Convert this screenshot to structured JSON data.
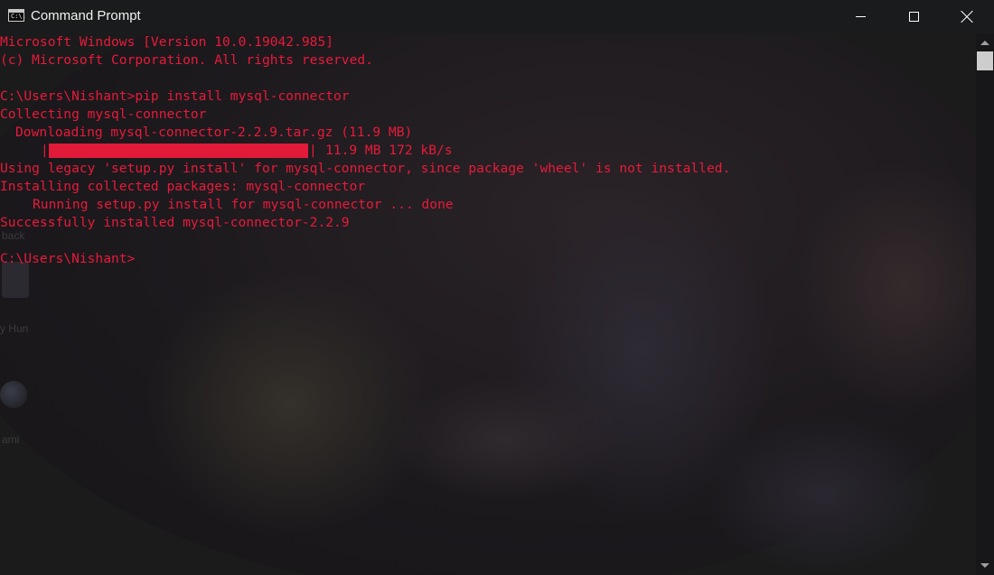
{
  "window": {
    "title": "Command Prompt",
    "icon": "cmd-icon",
    "icon_text": "C:\\.",
    "controls": {
      "minimize": "minimize-icon",
      "maximize": "maximize-icon",
      "close": "close-icon"
    }
  },
  "colors": {
    "console_text": "#e81a3a",
    "titlebar": "#1a1b1c",
    "progress_fill": "#e11a3a"
  },
  "console": {
    "lines": [
      "Microsoft Windows [Version 10.0.19042.985]",
      "(c) Microsoft Corporation. All rights reserved.",
      "",
      "C:\\Users\\Nishant>pip install mysql-connector",
      "Collecting mysql-connector",
      "Downloading mysql-connector-2.2.9.tar.gz (11.9 MB)"
    ],
    "progress": {
      "fraction": 1.0,
      "left_bar": "|",
      "right_bar": "|",
      "text": "11.9 MB 172 kB/s"
    },
    "lines_after": [
      "Using legacy 'setup.py install' for mysql-connector, since package 'wheel' is not installed.",
      "Installing collected packages: mysql-connector",
      "Running setup.py install for mysql-connector ... done",
      "Successfully installed mysql-connector-2.2.9",
      "",
      "C:\\Users\\Nishant>"
    ]
  },
  "background_desktop": {
    "labels": [
      "back",
      "y Hun",
      "ami"
    ]
  },
  "scrollbar": {
    "up": "scroll-up-arrow-icon",
    "down": "scroll-down-arrow-icon"
  }
}
